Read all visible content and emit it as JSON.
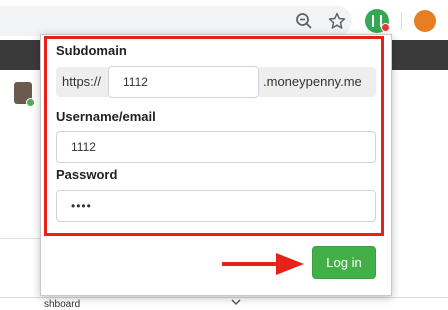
{
  "browser": {
    "toolbar_icons": [
      "zoom-out-icon",
      "star-icon",
      "moneypenny-extension-icon",
      "profile-avatar"
    ],
    "colors": {
      "extension_icon": "#34a853",
      "extension_badge": "#e53935"
    }
  },
  "background": {
    "dropdown_text": "shboard"
  },
  "login_popup": {
    "subdomain_label": "Subdomain",
    "subdomain_prefix": "https://",
    "subdomain_value": "1112",
    "subdomain_suffix": ".moneypenny.me",
    "username_label": "Username/email",
    "username_value": "1112",
    "password_label": "Password",
    "password_value": "••••",
    "login_button_label": "Log in",
    "colors": {
      "highlight_box": "#e62117",
      "arrow": "#e62117",
      "login_button": "#43b047"
    }
  }
}
